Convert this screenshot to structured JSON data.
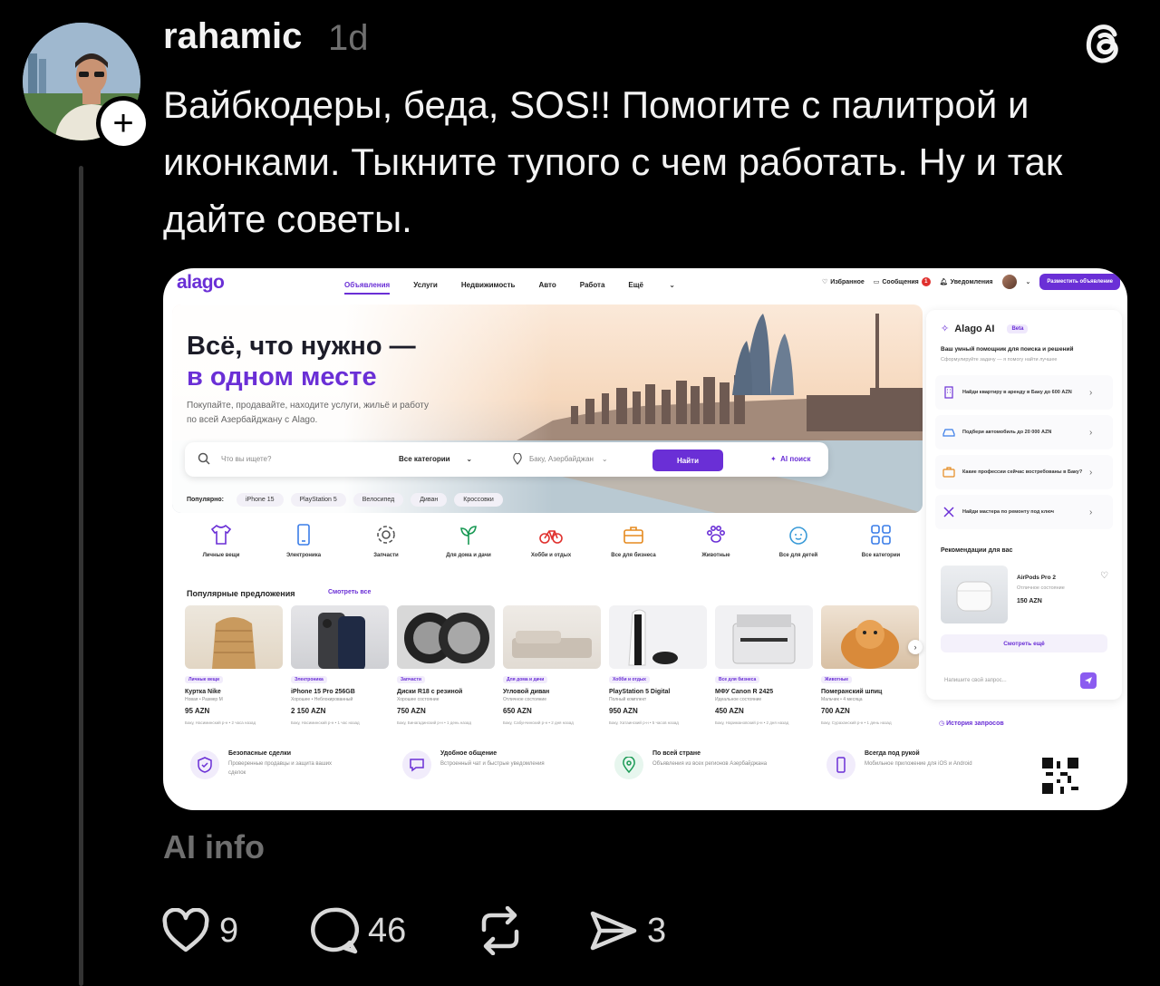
{
  "post": {
    "username": "rahamic",
    "time": "1d",
    "text": "Вайбкодеры, беда, SOS!! Помогите с палитрой и иконками. Тыкните тупого с чем работать. Ну и так дайте советы.",
    "ai_info": "AI info",
    "follow_icon": "plus-icon",
    "app_icon": "threads-logo-icon"
  },
  "actions": {
    "likes": "9",
    "comments": "46",
    "shares": "3"
  },
  "shot": {
    "logo": "alago",
    "nav": [
      "Объявления",
      "Услуги",
      "Недвижимость",
      "Авто",
      "Работа",
      "Ещё"
    ],
    "nav_right": {
      "favorites": "Избранное",
      "messages": "Сообщения",
      "messages_badge": "1",
      "notifications": "Уведомления",
      "post_ad": "Разместить объявление"
    },
    "hero": {
      "title1": "Всё, что нужно —",
      "title2": "в одном месте",
      "subtitle": "Покупайте, продавайте, находите услуги, жильё и работу по всей Азербайджану с Alago."
    },
    "search": {
      "placeholder": "Что вы ищете?",
      "category": "Все категории",
      "location": "Баку, Азербайджан",
      "find": "Найти",
      "ai": "AI поиск"
    },
    "popular": {
      "label": "Популярно:",
      "chips": [
        "iPhone 15",
        "PlayStation 5",
        "Велосипед",
        "Диван",
        "Кроссовки"
      ]
    },
    "categories": [
      {
        "label": "Личные вещи",
        "icon": "shirt-icon"
      },
      {
        "label": "Электроника",
        "icon": "phone-icon"
      },
      {
        "label": "Запчасти",
        "icon": "gear-icon"
      },
      {
        "label": "Для дома и дачи",
        "icon": "plant-icon"
      },
      {
        "label": "Хобби и отдых",
        "icon": "bicycle-icon"
      },
      {
        "label": "Все для бизнеса",
        "icon": "briefcase-icon"
      },
      {
        "label": "Животные",
        "icon": "paw-icon"
      },
      {
        "label": "Все для детей",
        "icon": "baby-icon"
      },
      {
        "label": "Все категории",
        "icon": "grid-icon"
      }
    ],
    "offers": {
      "title": "Популярные предложения",
      "link": "Смотреть все",
      "items": [
        {
          "tag": "Личные вещи",
          "title": "Куртка Nike",
          "sub": "Новая • Размер M",
          "price": "95 AZN",
          "loc": "Баку, Насиминский р-н • 2 часа назад",
          "img": "jacket"
        },
        {
          "tag": "Электроника",
          "title": "iPhone 15 Pro 256GB",
          "sub": "Хорошее • Неблокированный",
          "price": "2 150 AZN",
          "loc": "Баку, Насиминский р-н • 1 час назад",
          "img": "phone"
        },
        {
          "tag": "Запчасти",
          "title": "Диски R18 с резиной",
          "sub": "Хорошее состояние",
          "price": "750 AZN",
          "loc": "Баку, Бинагадинский р-н • 1 день назад",
          "img": "wheels"
        },
        {
          "tag": "Для дома и дачи",
          "title": "Угловой диван",
          "sub": "Отличное состояние",
          "price": "650 AZN",
          "loc": "Баку, Сабунчинский р-н • 2 дня назад",
          "img": "sofa"
        },
        {
          "tag": "Хобби и отдых",
          "title": "PlayStation 5 Digital",
          "sub": "Полный комплект",
          "price": "950 AZN",
          "loc": "Баку, Хатаинский р-н • 5 часов назад",
          "img": "ps5"
        },
        {
          "tag": "Все для бизнеса",
          "title": "МФУ Canon R 2425",
          "sub": "Идеальное состояние",
          "price": "450 AZN",
          "loc": "Баку, Наримановский р-н • 2 дня назад",
          "img": "printer"
        },
        {
          "tag": "Животные",
          "title": "Померанский шпиц",
          "sub": "Мальчик • 4 месяца",
          "price": "700 AZN",
          "loc": "Баку, Сураханский р-н • 1 день назад",
          "img": "dog"
        }
      ]
    },
    "features": [
      {
        "title": "Безопасные сделки",
        "desc": "Проверенные продавцы и защита ваших сделок",
        "icon": "shield-icon",
        "color": "#6a2fd6",
        "bg": "#f1ecfb"
      },
      {
        "title": "Удобное общение",
        "desc": "Встроенный чат и быстрые уведомления",
        "icon": "chat-icon",
        "color": "#6a2fd6",
        "bg": "#f1ecfb"
      },
      {
        "title": "По всей стране",
        "desc": "Объявления из всех регионов Азербайджана",
        "icon": "map-pin-icon",
        "color": "#1a9a55",
        "bg": "#e7f6ee"
      },
      {
        "title": "Всегда под рукой",
        "desc": "Мобильное приложение для iOS и Android",
        "icon": "smartphone-icon",
        "color": "#6a2fd6",
        "bg": "#f1ecfb"
      }
    ],
    "ai_panel": {
      "title": "Alago AI",
      "beta": "Beta",
      "line1": "Ваш умный помощник для поиска и решений",
      "line2": "Сформулируйте задачу — я помогу найти лучшее",
      "suggestions": [
        {
          "text": "Найди квартиру в аренду в Баку до 600 AZN",
          "icon": "building-icon"
        },
        {
          "text": "Подбери автомобиль до 20 000 AZN",
          "icon": "car-icon"
        },
        {
          "text": "Какие профессии сейчас востребованы в Баку?",
          "icon": "briefcase-icon"
        },
        {
          "text": "Найди мастера по ремонту под ключ",
          "icon": "tools-icon"
        }
      ],
      "rec_title": "Рекомендации для вас",
      "rec": {
        "title": "AirPods Pro 2",
        "sub": "Отличное состояние",
        "price": "150 AZN"
      },
      "more": "Смотреть ещё",
      "input_placeholder": "Напишите свой запрос...",
      "history": "История запросов"
    },
    "accent_color": "#6a2fd6"
  }
}
